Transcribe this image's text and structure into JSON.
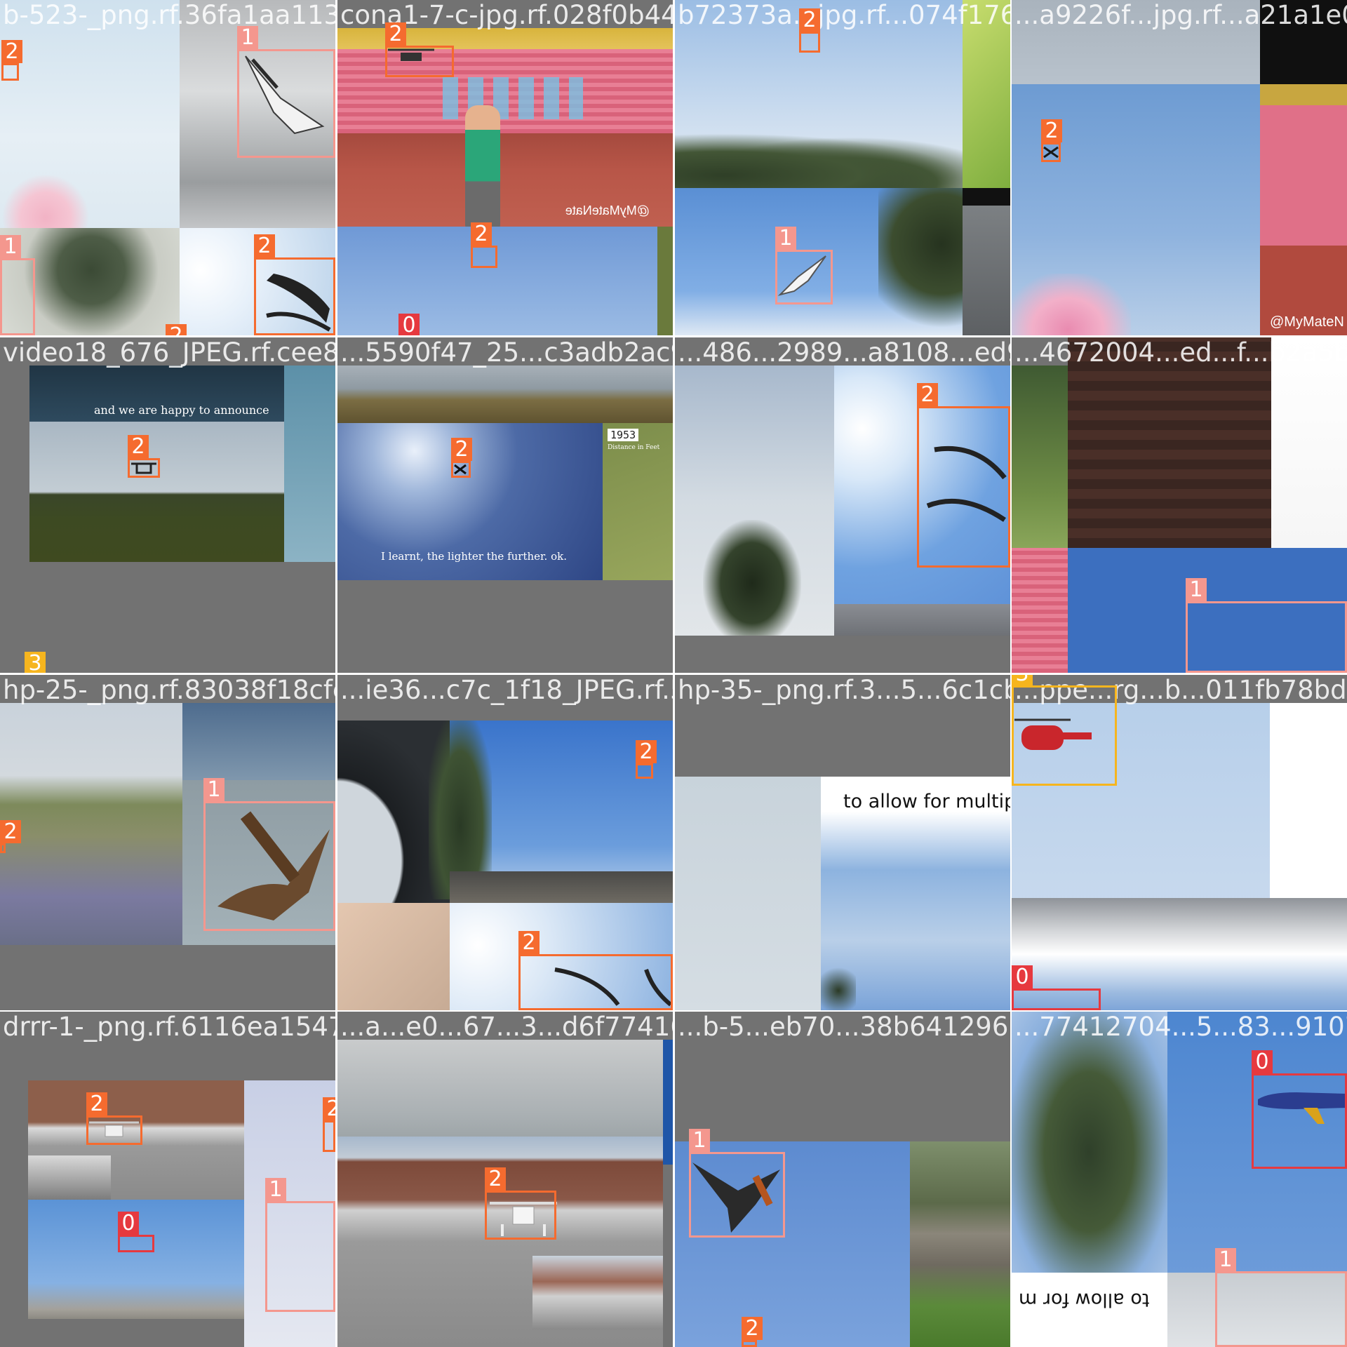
{
  "class_colors": {
    "0": "#e6393f",
    "1": "#f4978e",
    "2": "#f56b2f",
    "3": "#f6b51e"
  },
  "tiles": [
    {
      "filename": "b-523-_png.rf.36fa1aa1137aeca1c7..."
    },
    {
      "filename": "cona1-7-c-jpg.rf.028f0b44bb11..."
    },
    {
      "filename": "b72373a...jpg.rf...074f1764a9e..."
    },
    {
      "filename": "...a9226f...jpg.rf...a21a1e0427..."
    },
    {
      "filename": "video18_676_JPEG.rf.cee8ba..."
    },
    {
      "filename": "...5590f47_25...c3adb2ac9f54..."
    },
    {
      "filename": "...486...2989...a8108...ed91c4b72..."
    },
    {
      "filename": "...4672004...ed...f...b2a5be3fc7..."
    },
    {
      "filename": "hp-25-_png.rf.83038f18cfe3e..."
    },
    {
      "filename": "...ie36...c7c_1f18_JPEG.rf.55378935..."
    },
    {
      "filename": "hp-35-_png.rf.3...5...6c1cba6fb..."
    },
    {
      "filename": "...ppe...rg...b...011fb78bda5c..."
    },
    {
      "filename": "drrr-1-_png.rf.6116ea154770..."
    },
    {
      "filename": "...a...e0...67...3...d6f77416ebe..."
    },
    {
      "filename": "...b-5...eb70...38b641296..."
    },
    {
      "filename": "...77412704...5...83...9107f8952..."
    }
  ],
  "boxes": [
    {
      "class_id": "2"
    },
    {
      "class_id": "1"
    },
    {
      "class_id": "1"
    },
    {
      "class_id": "2"
    },
    {
      "class_id": "2"
    },
    {
      "class_id": "2"
    },
    {
      "class_id": "2"
    },
    {
      "class_id": "0"
    },
    {
      "class_id": "2"
    },
    {
      "class_id": "1"
    },
    {
      "class_id": "2"
    },
    {
      "class_id": "2"
    },
    {
      "class_id": "3"
    },
    {
      "class_id": "2"
    },
    {
      "class_id": "2"
    },
    {
      "class_id": "1"
    },
    {
      "class_id": "1"
    },
    {
      "class_id": "2"
    },
    {
      "class_id": "2"
    },
    {
      "class_id": "2"
    },
    {
      "class_id": "3"
    },
    {
      "class_id": "0"
    },
    {
      "class_id": "2"
    },
    {
      "class_id": "2"
    },
    {
      "class_id": "1"
    },
    {
      "class_id": "0"
    },
    {
      "class_id": "2"
    },
    {
      "class_id": "1"
    },
    {
      "class_id": "2"
    },
    {
      "class_id": "0"
    },
    {
      "class_id": "1"
    }
  ],
  "overlay_texts": {
    "watermark_a": "@MyMateNate",
    "watermark_b": "@MyMateN",
    "caption_announce": "and we are happy to announce",
    "badge_1953": "1953",
    "badge_distance": "Distance in Feet",
    "caption_lighter": "I learnt, the lighter the further. ok.",
    "caption_allow": "to allow for multip",
    "caption_allow_mirrored": "to allow for m"
  }
}
